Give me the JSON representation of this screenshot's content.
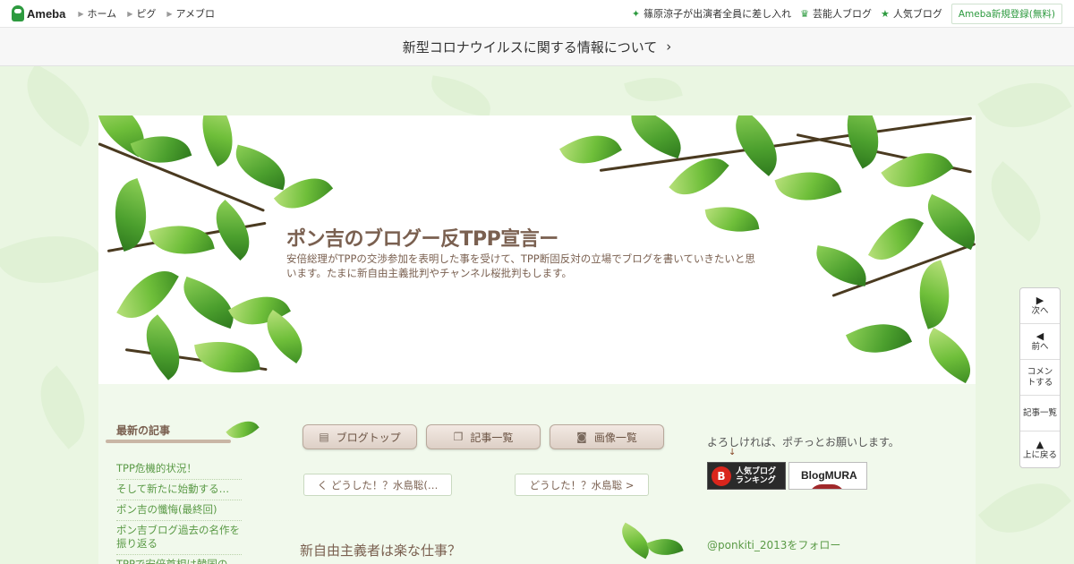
{
  "topbar": {
    "logo_text": "Ameba",
    "links": [
      "ホーム",
      "ピグ",
      "アメブロ"
    ],
    "right_links": [
      {
        "icon": "sparkle-icon",
        "label": "篠原涼子が出演者全員に差し入れ"
      },
      {
        "icon": "crown-icon",
        "label": "芸能人ブログ"
      },
      {
        "icon": "star-icon",
        "label": "人気ブログ"
      }
    ],
    "register_label": "Ameba新規登録(無料)"
  },
  "notice": {
    "text": "新型コロナウイルスに関する情報について"
  },
  "header": {
    "title": "ポン吉のブログー反TPP宣言ー",
    "description": "安倍総理がTPPの交渉参加を表明した事を受けて、TPP断固反対の立場でブログを書いていきたいと思います。たまに新自由主義批判やチャンネル桜批判もします。"
  },
  "sidebar": {
    "heading": "最新の記事",
    "items": [
      {
        "label": "TPP危機的状況！"
      },
      {
        "label": "そして新たに始動する…"
      },
      {
        "label": "ポン吉の懺悔(最終回)"
      },
      {
        "label": "ポン吉ブログ過去の名作を振り返る"
      },
      {
        "label": "TPPで安倍首相は韓国の"
      }
    ]
  },
  "nav_buttons": [
    {
      "icon": "document-icon",
      "label": "ブログトップ"
    },
    {
      "icon": "copy-icon",
      "label": "記事一覧"
    },
    {
      "icon": "camera-icon",
      "label": "画像一覧"
    }
  ],
  "pager": {
    "prev_label": "く どうした！？水島聡(…",
    "next_label": "どうした！？水島聡 >"
  },
  "entry": {
    "title": "新自由主義者は楽な仕事？"
  },
  "right_sidebar": {
    "text": "よろしければ、ポチっとお願いします。",
    "arrow": "↓",
    "banner1_line1": "人気ブログ",
    "banner1_line2": "ランキング",
    "banner2_label": "BlogMURA",
    "follow_label": "@ponkiti_2013をフォロー"
  },
  "float_nav": [
    {
      "icon": "play-right-icon",
      "glyph": "▶",
      "label": "次へ"
    },
    {
      "icon": "play-left-icon",
      "glyph": "◀",
      "label": "前へ"
    },
    {
      "icon": "",
      "glyph": "",
      "label": "コメントする"
    },
    {
      "icon": "",
      "glyph": "",
      "label": "記事一覧"
    },
    {
      "icon": "up-triangle-icon",
      "glyph": "▲",
      "label": "上に戻る"
    }
  ],
  "colors": {
    "brand_green": "#2d9a3f",
    "title_brown": "#7a6050",
    "link_green": "#5a9a46",
    "page_bg": "#eaf6e2"
  }
}
